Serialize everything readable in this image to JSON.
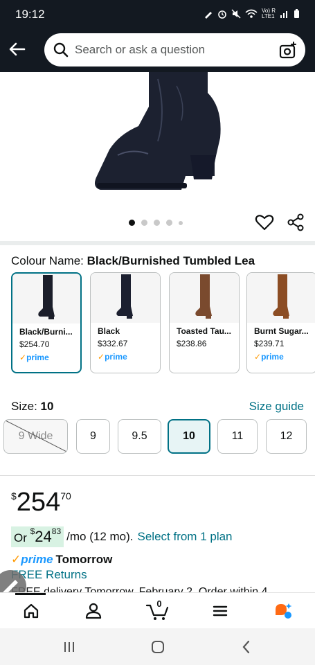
{
  "status_bar": {
    "time": "19:12",
    "network_label": "Vo) R\nLTE1"
  },
  "header": {
    "back_icon": "arrow-left-icon",
    "search_placeholder": "Search or ask a question",
    "camera_icon": "camera-search-icon"
  },
  "gallery": {
    "image_count": 5,
    "active_index": 0
  },
  "colour": {
    "label": "Colour Name: ",
    "selected_value": "Black/Burnished Tumbled Lea",
    "options": [
      {
        "name": "Black/Burni...",
        "price": "$254.70",
        "prime": "prime",
        "selected": true,
        "boot_color": "#1b1e2a"
      },
      {
        "name": "Black",
        "price": "$332.67",
        "prime": "prime",
        "selected": false,
        "boot_color": "#1c2030"
      },
      {
        "name": "Toasted Tau...",
        "price": "$238.86",
        "prime": "",
        "selected": false,
        "boot_color": "#7a4a2e"
      },
      {
        "name": "Burnt Sugar...",
        "price": "$239.71",
        "prime": "prime",
        "selected": false,
        "boot_color": "#8c4d24"
      }
    ]
  },
  "size": {
    "label": "Size: ",
    "selected_value": "10",
    "guide_link": "Size guide",
    "options": [
      {
        "label": "9 Wide",
        "available": false,
        "selected": false
      },
      {
        "label": "9",
        "available": true,
        "selected": false
      },
      {
        "label": "9.5",
        "available": true,
        "selected": false
      },
      {
        "label": "10",
        "available": true,
        "selected": true
      },
      {
        "label": "11",
        "available": true,
        "selected": false
      },
      {
        "label": "12",
        "available": true,
        "selected": false
      }
    ]
  },
  "price": {
    "currency": "$",
    "whole": "254",
    "fraction": "70"
  },
  "monthly": {
    "prefix": "Or ",
    "currency": "$",
    "whole": "24",
    "fraction": "83",
    "rest": "/mo (12 mo).",
    "link": "Select from 1 plan"
  },
  "delivery": {
    "prime_word": "prime",
    "speed": "Tomorrow",
    "returns_link": "FREE Returns",
    "cut_text": "FREE delivery Tomorrow, February 2. Order within 4"
  },
  "bottom_nav": {
    "cart_count": "0",
    "items": [
      "home-icon",
      "account-icon",
      "cart-icon",
      "menu-icon",
      "rufus-icon"
    ]
  },
  "colors": {
    "header_bg": "#131921",
    "link": "#007185",
    "selected_border": "#007185",
    "prime_blue": "#1a98ff",
    "prime_orange": "#ff9900",
    "emi_badge_bg": "#d8f2e3"
  }
}
